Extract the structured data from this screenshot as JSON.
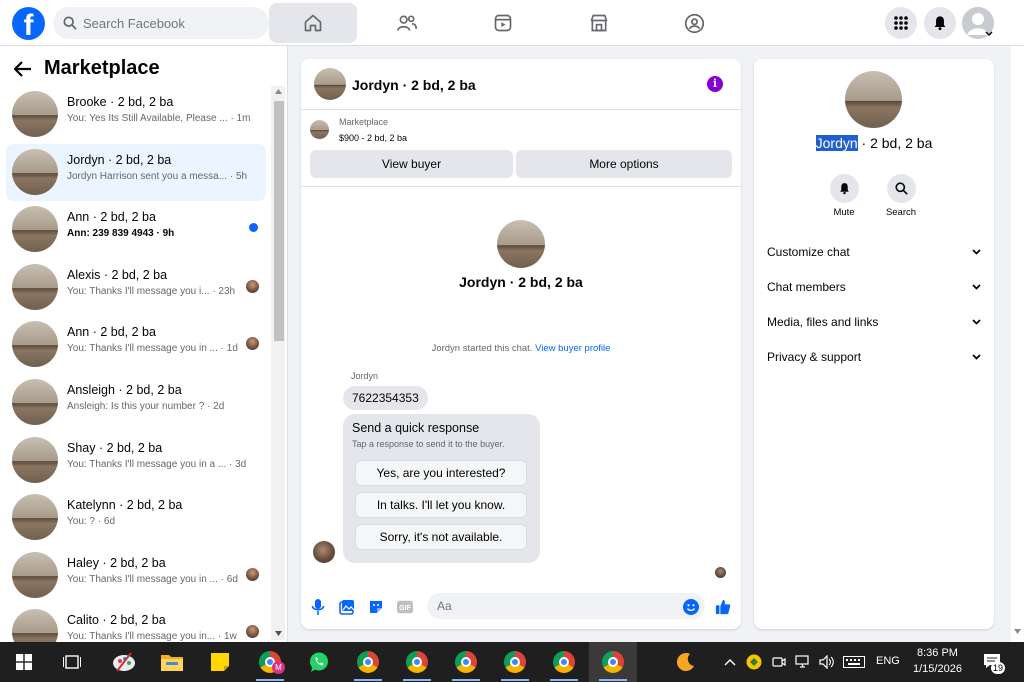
{
  "topbar": {
    "search_placeholder": "Search Facebook",
    "nav_tabs": [
      "home-icon",
      "friends-icon",
      "watch-icon",
      "marketplace-icon",
      "groups-icon"
    ],
    "active_tab": "home-icon"
  },
  "marketplace": {
    "title": "Marketplace",
    "chats": [
      {
        "name": "Brooke · 2 bd, 2 ba",
        "preview": "You: Yes Its Still Available, Please ... · 1m",
        "badge": "none"
      },
      {
        "name": "Jordyn · 2 bd, 2 ba",
        "preview": "Jordyn Harrison sent you a messa... · 5h",
        "badge": "none",
        "selected": true
      },
      {
        "name": "Ann · 2 bd, 2 ba",
        "preview": "Ann: 239 839 4943 · 9h",
        "badge": "unread",
        "bold": true
      },
      {
        "name": "Alexis · 2 bd, 2 ba",
        "preview": "You: Thanks I'll message you i... · 23h",
        "badge": "seen"
      },
      {
        "name": "Ann · 2 bd, 2 ba",
        "preview": "You: Thanks I'll message you in ... · 1d",
        "badge": "seen"
      },
      {
        "name": "Ansleigh · 2 bd, 2 ba",
        "preview": "Ansleigh: Is this your number ? · 2d",
        "badge": "none"
      },
      {
        "name": "Shay · 2 bd, 2 ba",
        "preview": "You: Thanks I'll message you in a ... · 3d",
        "badge": "none"
      },
      {
        "name": "Katelynn · 2 bd, 2 ba",
        "preview": "You: ? · 6d",
        "badge": "none"
      },
      {
        "name": "Haley · 2 bd, 2 ba",
        "preview": "You: Thanks I'll message you in ... · 6d",
        "badge": "seen"
      },
      {
        "name": "Calito · 2 bd, 2 ba",
        "preview": "You: Thanks I'll message you in... · 1w",
        "badge": "seen"
      }
    ]
  },
  "conversation": {
    "header_name": "Jordyn · 2 bd, 2 ba",
    "listing_label": "Marketplace",
    "listing_price": "$900 - 2 bd, 2 ba",
    "view_buyer": "View buyer",
    "more_options": "More options",
    "intro_name": "Jordyn · 2 bd, 2 ba",
    "system_text": "Jordyn started this chat.",
    "system_link": "View buyer profile",
    "sender": "Jordyn",
    "message": "7622354353",
    "quick_title": "Send a quick response",
    "quick_sub": "Tap a response to send it to the buyer.",
    "quick_responses": [
      "Yes, are you interested?",
      "In talks. I'll let you know.",
      "Sorry, it's not available."
    ],
    "composer_placeholder": "Aa"
  },
  "details": {
    "name_highlight": "Jordyn",
    "name_rest": " · 2 bd, 2 ba",
    "mute": "Mute",
    "search": "Search",
    "sections": [
      "Customize chat",
      "Chat members",
      "Media, files and links",
      "Privacy & support"
    ]
  },
  "taskbar": {
    "language": "ENG",
    "time": "8:36 PM",
    "date": "1/15/2026",
    "notifications": "19"
  }
}
